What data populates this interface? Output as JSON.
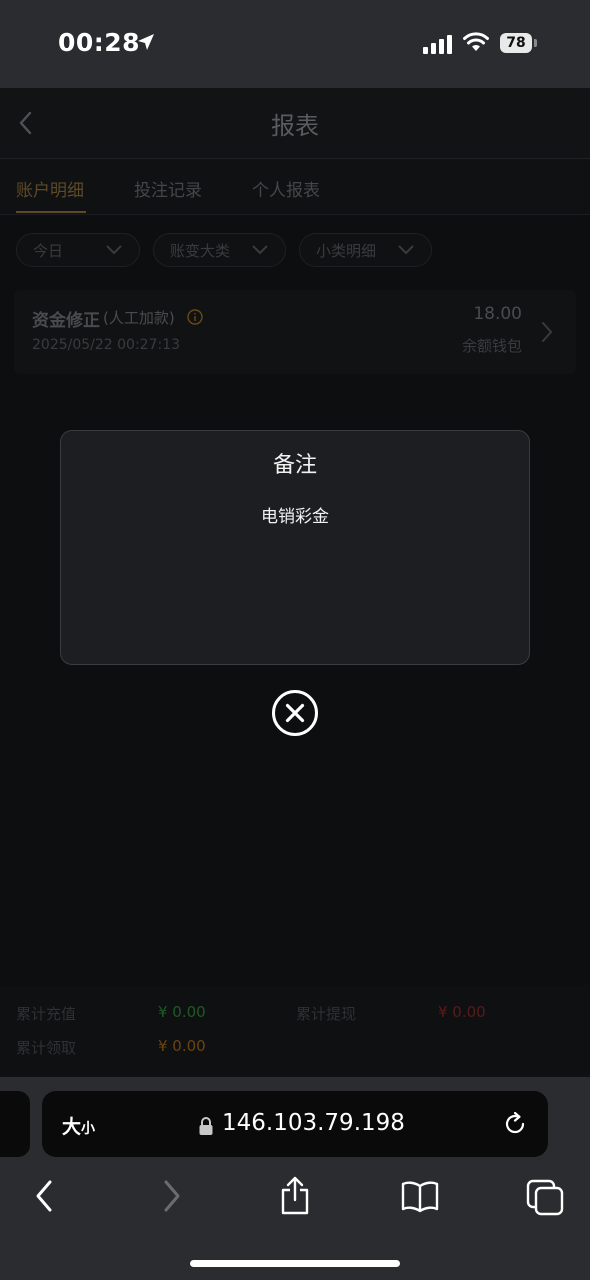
{
  "status_bar": {
    "time": "00:28",
    "battery": "78"
  },
  "header": {
    "title": "报表"
  },
  "tabs": [
    {
      "label": "账户明细",
      "active": true
    },
    {
      "label": "投注记录",
      "active": false
    },
    {
      "label": "个人报表",
      "active": false
    }
  ],
  "filters": [
    {
      "label": "今日"
    },
    {
      "label": "账变大类"
    },
    {
      "label": "小类明细"
    }
  ],
  "record": {
    "title": "资金修正",
    "subtitle": "(人工加款)",
    "time": "2025/05/22 00:27:13",
    "amount": "18.00",
    "wallet": "余额钱包"
  },
  "summary": {
    "deposit_label": "累计充值",
    "deposit_value": "¥ 0.00",
    "withdraw_label": "累计提现",
    "withdraw_value": "¥ 0.00",
    "claim_label": "累计领取",
    "claim_value": "¥ 0.00"
  },
  "modal": {
    "title": "备注",
    "body": "电销彩金"
  },
  "browser": {
    "text_size_big": "大",
    "text_size_small": "小",
    "url": "146.103.79.198"
  },
  "colors": {
    "accent": "#c9a25a",
    "green": "#1f8a2b",
    "red": "#8a1f1f",
    "orange": "#a86a0f"
  }
}
